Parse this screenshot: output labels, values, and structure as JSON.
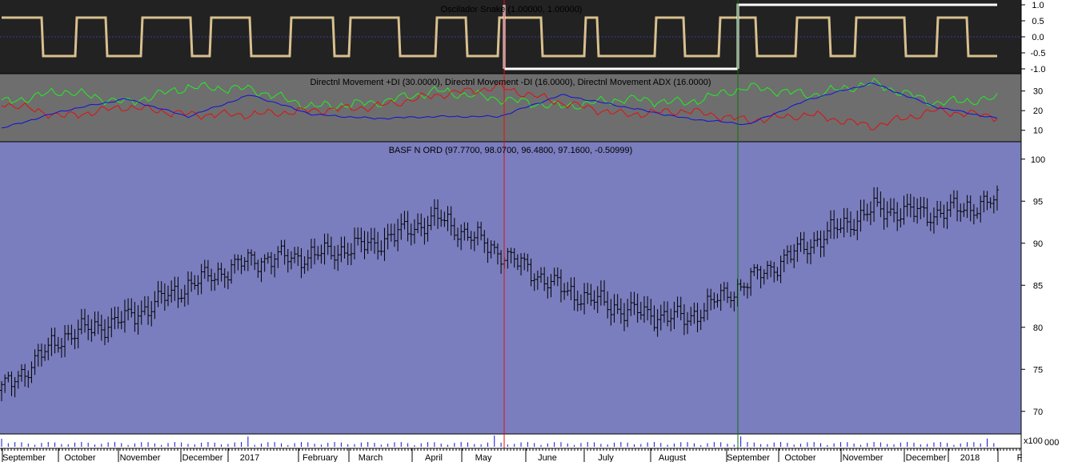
{
  "colors": {
    "osc_bg": "#222222",
    "dmi_bg": "#6e6e6e",
    "price_bg": "#7a7ebe",
    "osc_line": "#d8c08e",
    "osc_line_alt": "#ffffff",
    "dmi_plus": "#22ee22",
    "dmi_minus": "#e01010",
    "dmi_adx": "#1010dd",
    "bars": "#000000",
    "marker_red": "#e01010",
    "marker_green": "#107010",
    "volume": "#1010dd"
  },
  "oscillator": {
    "title": "Oscilador Snake (1.00000, 1.00000)",
    "ticks": [
      "1.0",
      "0.5",
      "0.0",
      "-0.5",
      "-1.0"
    ],
    "tick_values": [
      1.0,
      0.5,
      0.0,
      -0.5,
      -1.0
    ],
    "ylim": [
      -1.0,
      1.0
    ]
  },
  "dmi": {
    "title": "Directnl Movement +DI (30.0000), Directnl Movement -DI (16.0000), Directnl Movement ADX (16.0000)",
    "ticks": [
      "30",
      "20",
      "10"
    ],
    "tick_values": [
      30,
      20,
      10
    ],
    "ylim": [
      5,
      38
    ]
  },
  "price": {
    "title": "BASF N ORD (97.7700, 98.0700, 96.4800, 97.1600, -0.50999)",
    "ticks": [
      "100",
      "95",
      "90",
      "85",
      "80",
      "75",
      "70"
    ],
    "tick_values": [
      100,
      95,
      90,
      85,
      80,
      75,
      70
    ],
    "ylim": [
      67.5,
      101.5
    ]
  },
  "volume": {
    "scale_label": "x100",
    "zero_label": "000"
  },
  "x_axis": {
    "labels": [
      "September",
      "October",
      "November",
      "December",
      "2017",
      "February",
      "March",
      "April",
      "May",
      "June",
      "July",
      "August",
      "September",
      "October",
      "November",
      "December",
      "2018",
      "F"
    ]
  },
  "chart_data": {
    "type": "line",
    "title": "BASF N ORD (97.7700, 98.0700, 96.4800, 97.1600, -0.50999)",
    "x": [
      "September",
      "October",
      "November",
      "December",
      "2017",
      "February",
      "March",
      "April",
      "May",
      "June",
      "July",
      "August",
      "September",
      "October",
      "November",
      "December",
      "2018"
    ],
    "series": [
      {
        "name": "BASF N ORD",
        "values": [
          72.5,
          79.0,
          81.0,
          85.0,
          88.0,
          88.5,
          90.0,
          93.0,
          89.0,
          84.5,
          82.0,
          81.0,
          85.5,
          90.0,
          94.0,
          93.5,
          95.0
        ]
      },
      {
        "name": "Directnl Movement +DI",
        "values": [
          24,
          30,
          24,
          32,
          31,
          22,
          24,
          30,
          26,
          22,
          26,
          24,
          32,
          28,
          34,
          24,
          26
        ]
      },
      {
        "name": "Directnl Movement -DI",
        "values": [
          24,
          17,
          22,
          18,
          18,
          20,
          22,
          28,
          32,
          24,
          18,
          20,
          15,
          18,
          12,
          20,
          17
        ]
      },
      {
        "name": "Directnl Movement ADX",
        "values": [
          11,
          20,
          26,
          17,
          28,
          18,
          16,
          17,
          17,
          28,
          22,
          16,
          13,
          26,
          34,
          22,
          16
        ]
      }
    ],
    "ylim": [
      67.5,
      101.5
    ],
    "markers": [
      "May",
      "September"
    ]
  }
}
